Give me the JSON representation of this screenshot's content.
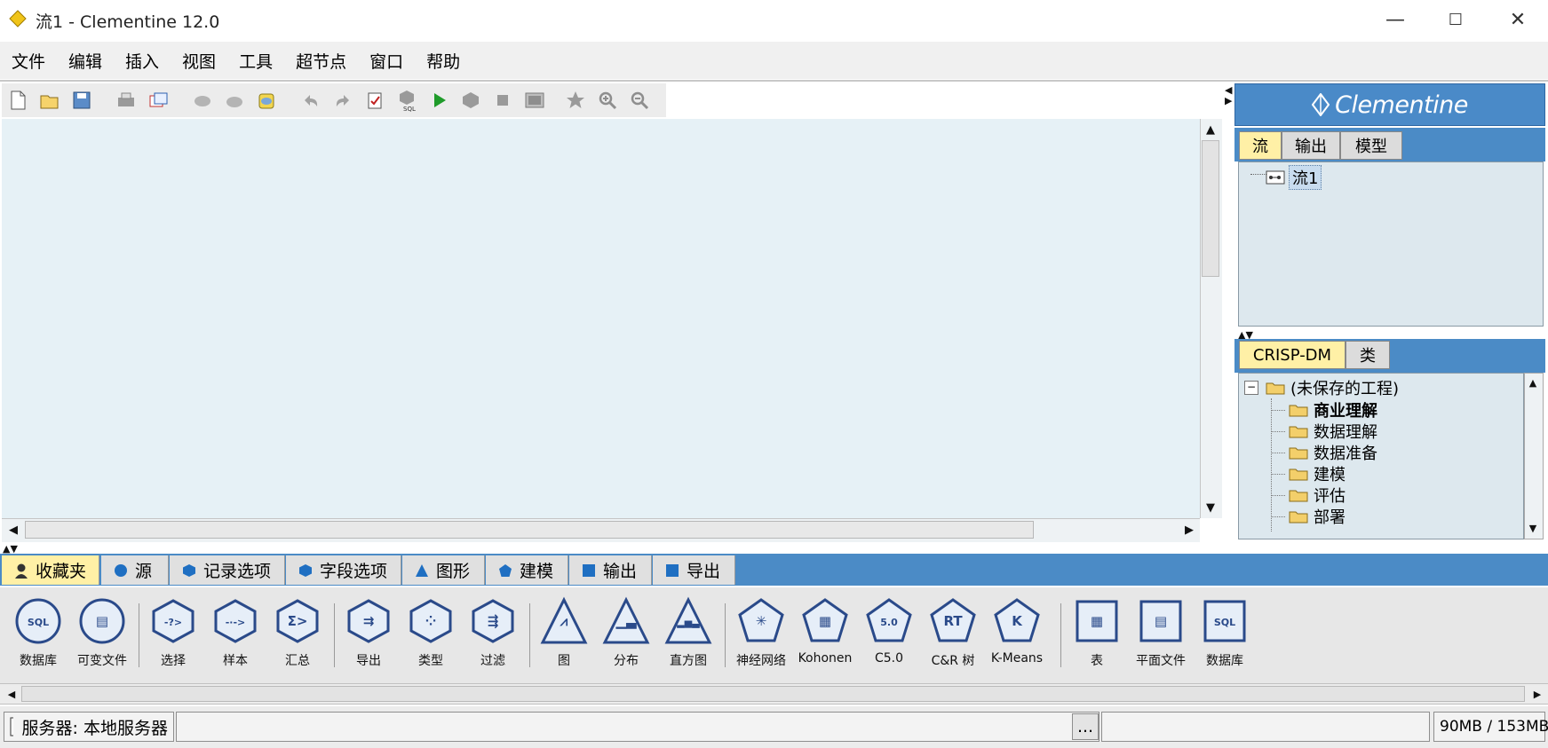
{
  "window": {
    "title": "流1 - Clementine 12.0",
    "minimize_glyph": "—",
    "maximize_glyph": "☐",
    "close_glyph": "✕"
  },
  "menu": [
    "文件",
    "编辑",
    "插入",
    "视图",
    "工具",
    "超节点",
    "窗口",
    "帮助"
  ],
  "toolbar": {
    "icons": [
      "new-stream-icon",
      "open-stream-icon",
      "save-stream-icon",
      "print-icon",
      "page-setup-icon",
      "cut-icon",
      "copy-icon",
      "paste-icon",
      "undo-icon",
      "redo-icon",
      "edit-icon",
      "sql-icon",
      "run-icon",
      "run-selection-icon",
      "stop-icon",
      "preview-icon",
      "star-icon",
      "zoom-in-icon",
      "zoom-out-icon"
    ]
  },
  "right_panel": {
    "logo": "Clementine",
    "stream_tabs": [
      "流",
      "输出",
      "模型"
    ],
    "stream_active_tab": 0,
    "streams": [
      "流1"
    ],
    "crisp_tabs": [
      "CRISP-DM",
      "类"
    ],
    "crisp_active_tab": 0,
    "project_root": "(未保存的工程)",
    "phases": [
      "商业理解",
      "数据理解",
      "数据准备",
      "建模",
      "评估",
      "部署"
    ]
  },
  "palette": {
    "tabs": [
      {
        "label": "收藏夹",
        "icon": "user-icon",
        "color": "#333333"
      },
      {
        "label": "源",
        "icon": "circle-icon",
        "color": "#1f6fc2"
      },
      {
        "label": "记录选项",
        "icon": "hexagon-icon",
        "color": "#1f6fc2"
      },
      {
        "label": "字段选项",
        "icon": "hexagon-icon",
        "color": "#1f6fc2"
      },
      {
        "label": "图形",
        "icon": "triangle-icon",
        "color": "#1f6fc2"
      },
      {
        "label": "建模",
        "icon": "pentagon-icon",
        "color": "#1f6fc2"
      },
      {
        "label": "输出",
        "icon": "square-icon",
        "color": "#1f6fc2"
      },
      {
        "label": "导出",
        "icon": "square-icon",
        "color": "#1f6fc2"
      }
    ],
    "nodes": [
      {
        "label": "数据库",
        "shape": "circle",
        "glyph": "SQL"
      },
      {
        "label": "可变文件",
        "shape": "circle",
        "glyph": "▤"
      },
      {
        "label": "选择",
        "shape": "hexagon",
        "glyph": "-?>"
      },
      {
        "label": "样本",
        "shape": "hexagon",
        "glyph": "-·->"
      },
      {
        "label": "汇总",
        "shape": "hexagon",
        "glyph": "Σ>"
      },
      {
        "label": "导出",
        "shape": "hexagon",
        "glyph": "⇉"
      },
      {
        "label": "类型",
        "shape": "hexagon",
        "glyph": "⁘"
      },
      {
        "label": "过滤",
        "shape": "hexagon",
        "glyph": "⇶"
      },
      {
        "label": "图",
        "shape": "triangle",
        "glyph": "⩘"
      },
      {
        "label": "分布",
        "shape": "triangle",
        "glyph": "▁▃"
      },
      {
        "label": "直方图",
        "shape": "triangle",
        "glyph": "▂▅▃"
      },
      {
        "label": "神经网络",
        "shape": "pentagon",
        "glyph": "✳"
      },
      {
        "label": "Kohonen",
        "shape": "pentagon",
        "glyph": "▦"
      },
      {
        "label": "C5.0",
        "shape": "pentagon",
        "glyph": "5.0"
      },
      {
        "label": "C&R 树",
        "shape": "pentagon",
        "glyph": "RT"
      },
      {
        "label": "K-Means",
        "shape": "pentagon",
        "glyph": "K"
      },
      {
        "label": "表",
        "shape": "square",
        "glyph": "▦"
      },
      {
        "label": "平面文件",
        "shape": "square",
        "glyph": "▤"
      },
      {
        "label": "数据库",
        "shape": "square",
        "glyph": "SQL"
      }
    ]
  },
  "status": {
    "server": "服务器: 本地服务器",
    "ellipsis": "...",
    "memory": "90MB / 153MB"
  }
}
